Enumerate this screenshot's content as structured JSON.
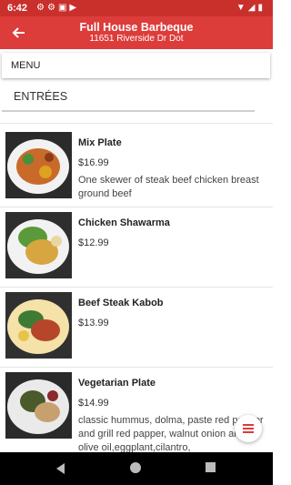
{
  "status_bar": {
    "time": "6:42"
  },
  "app_bar": {
    "title": "Full House Barbeque",
    "subtitle": "11651 Riverside Dr Dot"
  },
  "menu_label": "MENU",
  "category": "ENTRÉES",
  "items": [
    {
      "name": "Mix Plate",
      "price": "$16.99",
      "description": "One skewer of steak beef chicken breast ground beef"
    },
    {
      "name": "Chicken Shawarma",
      "price": "$12.99",
      "description": ""
    },
    {
      "name": "Beef Steak Kabob",
      "price": "$13.99",
      "description": ""
    },
    {
      "name": "Vegetarian Plate",
      "price": "$14.99",
      "description": "classic hummus, dolma, paste red pepper and grill red papper, walnut onion and olive oil,eggplant,cilantro,"
    }
  ],
  "colors": {
    "accent": "#dc3c3a",
    "status": "#c9302c"
  }
}
